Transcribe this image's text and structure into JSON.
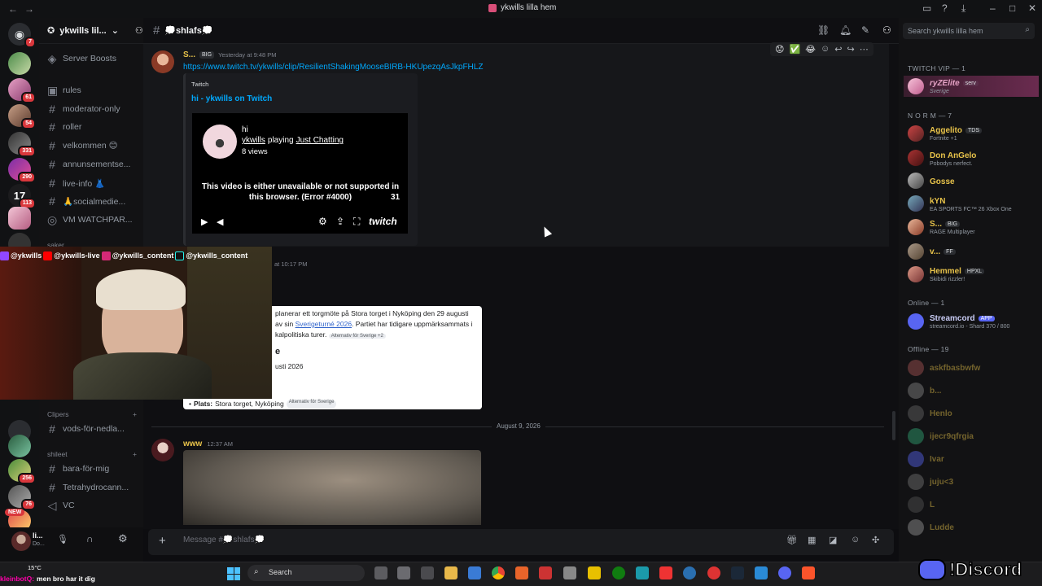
{
  "window": {
    "title": "ykwills lilla hem"
  },
  "server": {
    "name": "ykwills lil...",
    "search_placeholder": "Search ykwills lilla hem"
  },
  "rail_badges": [
    "7",
    "61",
    "54",
    "331",
    "290",
    "113",
    "256",
    "76",
    "NEW"
  ],
  "channels": [
    {
      "name": "Server Boosts"
    },
    {
      "name": "rules"
    },
    {
      "name": "moderator-only"
    },
    {
      "name": "roller"
    },
    {
      "name": "velkommen 😊"
    },
    {
      "name": "annunsementse..."
    },
    {
      "name": "live-info 👗"
    },
    {
      "name": "🙏socialmedie..."
    },
    {
      "name": "VM WATCHPAR..."
    },
    {
      "name": "vods-för-nedla..."
    },
    {
      "name": "bara-för-mig"
    },
    {
      "name": "Tetrahydrocann..."
    },
    {
      "name": "VC"
    }
  ],
  "categories": {
    "saker": "saker...",
    "clipers": "Clipers",
    "shileet": "shileet"
  },
  "current_channel": "💭shlafs💭",
  "messages": [
    {
      "author": "S...",
      "role_tag": "BIG",
      "time": "Yesterday at 9:48 PM",
      "link": "https://www.twitch.tv/ykwills/clip/ResilientShakingMooseBIRB-HKUpezqAsJkpFHLZ",
      "embed": {
        "provider": "Twitch",
        "title": "hi - ykwills on Twitch",
        "video_title": "hi",
        "channel": "ykwills",
        "playing_word": "playing",
        "game": "Just Chatting",
        "views": "8 views",
        "error": "This video is either unavailable or not supported in this browser. (Error #4000)",
        "duration": "31",
        "brand": "twitch"
      }
    },
    {
      "time": "at 10:17 PM",
      "article": {
        "line1": "planerar ett torgmöte på Stora torget i Nyköping den 29 augusti",
        "line2_pre": "av sin ",
        "line2_link": "Sverigeturné 2026",
        "line2_post": ". Partiet har tidigare uppmärksammats i",
        "line3": "kalpolitiska turer.",
        "tag1": "Alternativ för Sverige +2",
        "heading": "e",
        "date": "usti 2026",
        "plats_label": "Plats:",
        "plats_value": "Stora torget, Nyköping",
        "tag2": "Alternativ för Sverige"
      }
    }
  ],
  "divider_date": "August 9, 2026",
  "message3": {
    "author": "www",
    "time": "12:37 AM"
  },
  "composer_placeholder": "Message #💭shlafs💭",
  "user": {
    "name": "li...",
    "status": "Do..."
  },
  "members": {
    "vip_header": "TWITCH VIP — 1",
    "vip": [
      {
        "name": "ryZElite",
        "sub": "Sverige",
        "tag": "serv"
      }
    ],
    "norm_header": "N O R M — 7",
    "norm": [
      {
        "name": "Aggelito",
        "tag": "TDS",
        "sub": "Fortnite +1",
        "color": "#e8c34a"
      },
      {
        "name": "Don AnGelo",
        "tag": "",
        "sub": "Pobodys nerfect.",
        "color": "#e8c34a"
      },
      {
        "name": "Gosse",
        "tag": "",
        "sub": "",
        "color": "#e8c34a"
      },
      {
        "name": "kYN",
        "tag": "",
        "sub": "EA SPORTS FC™ 26 Xbox One",
        "color": "#e8c34a"
      },
      {
        "name": "S...",
        "tag": "BIG",
        "sub": "RAGE Multiplayer",
        "color": "#e8c34a"
      },
      {
        "name": "v...",
        "tag": "FF",
        "sub": "",
        "color": "#e8c34a"
      },
      {
        "name": "Hemmel",
        "tag": "HPXL",
        "sub": "Skibidi rizzler!",
        "color": "#e8c34a"
      }
    ],
    "online_header": "Online — 1",
    "online": [
      {
        "name": "Streamcord",
        "tag": "APP",
        "sub": "streamcord.io - Shard 370 / 800"
      }
    ],
    "offline_header": "Offline — 19",
    "offline": [
      "askfbasbwfw",
      "b...",
      "Henlo",
      "ijecr9qfrgia",
      "Ivar",
      "juju<3",
      "L",
      "Ludde"
    ]
  },
  "stream_overlay": [
    "@ykwills",
    "@ykwills-live",
    "@ykwills_content",
    "@ykwills_content"
  ],
  "chat_ticker": {
    "user": "kleinbotQ:",
    "text": "men bro har it dig"
  },
  "weather": "15°C",
  "taskbar_search": "Search",
  "discord_logo": "!Discord",
  "colors": {
    "accent": "#5865f2",
    "link": "#00a8fc",
    "twitch": "#9147ff",
    "mention": "#da373c"
  }
}
